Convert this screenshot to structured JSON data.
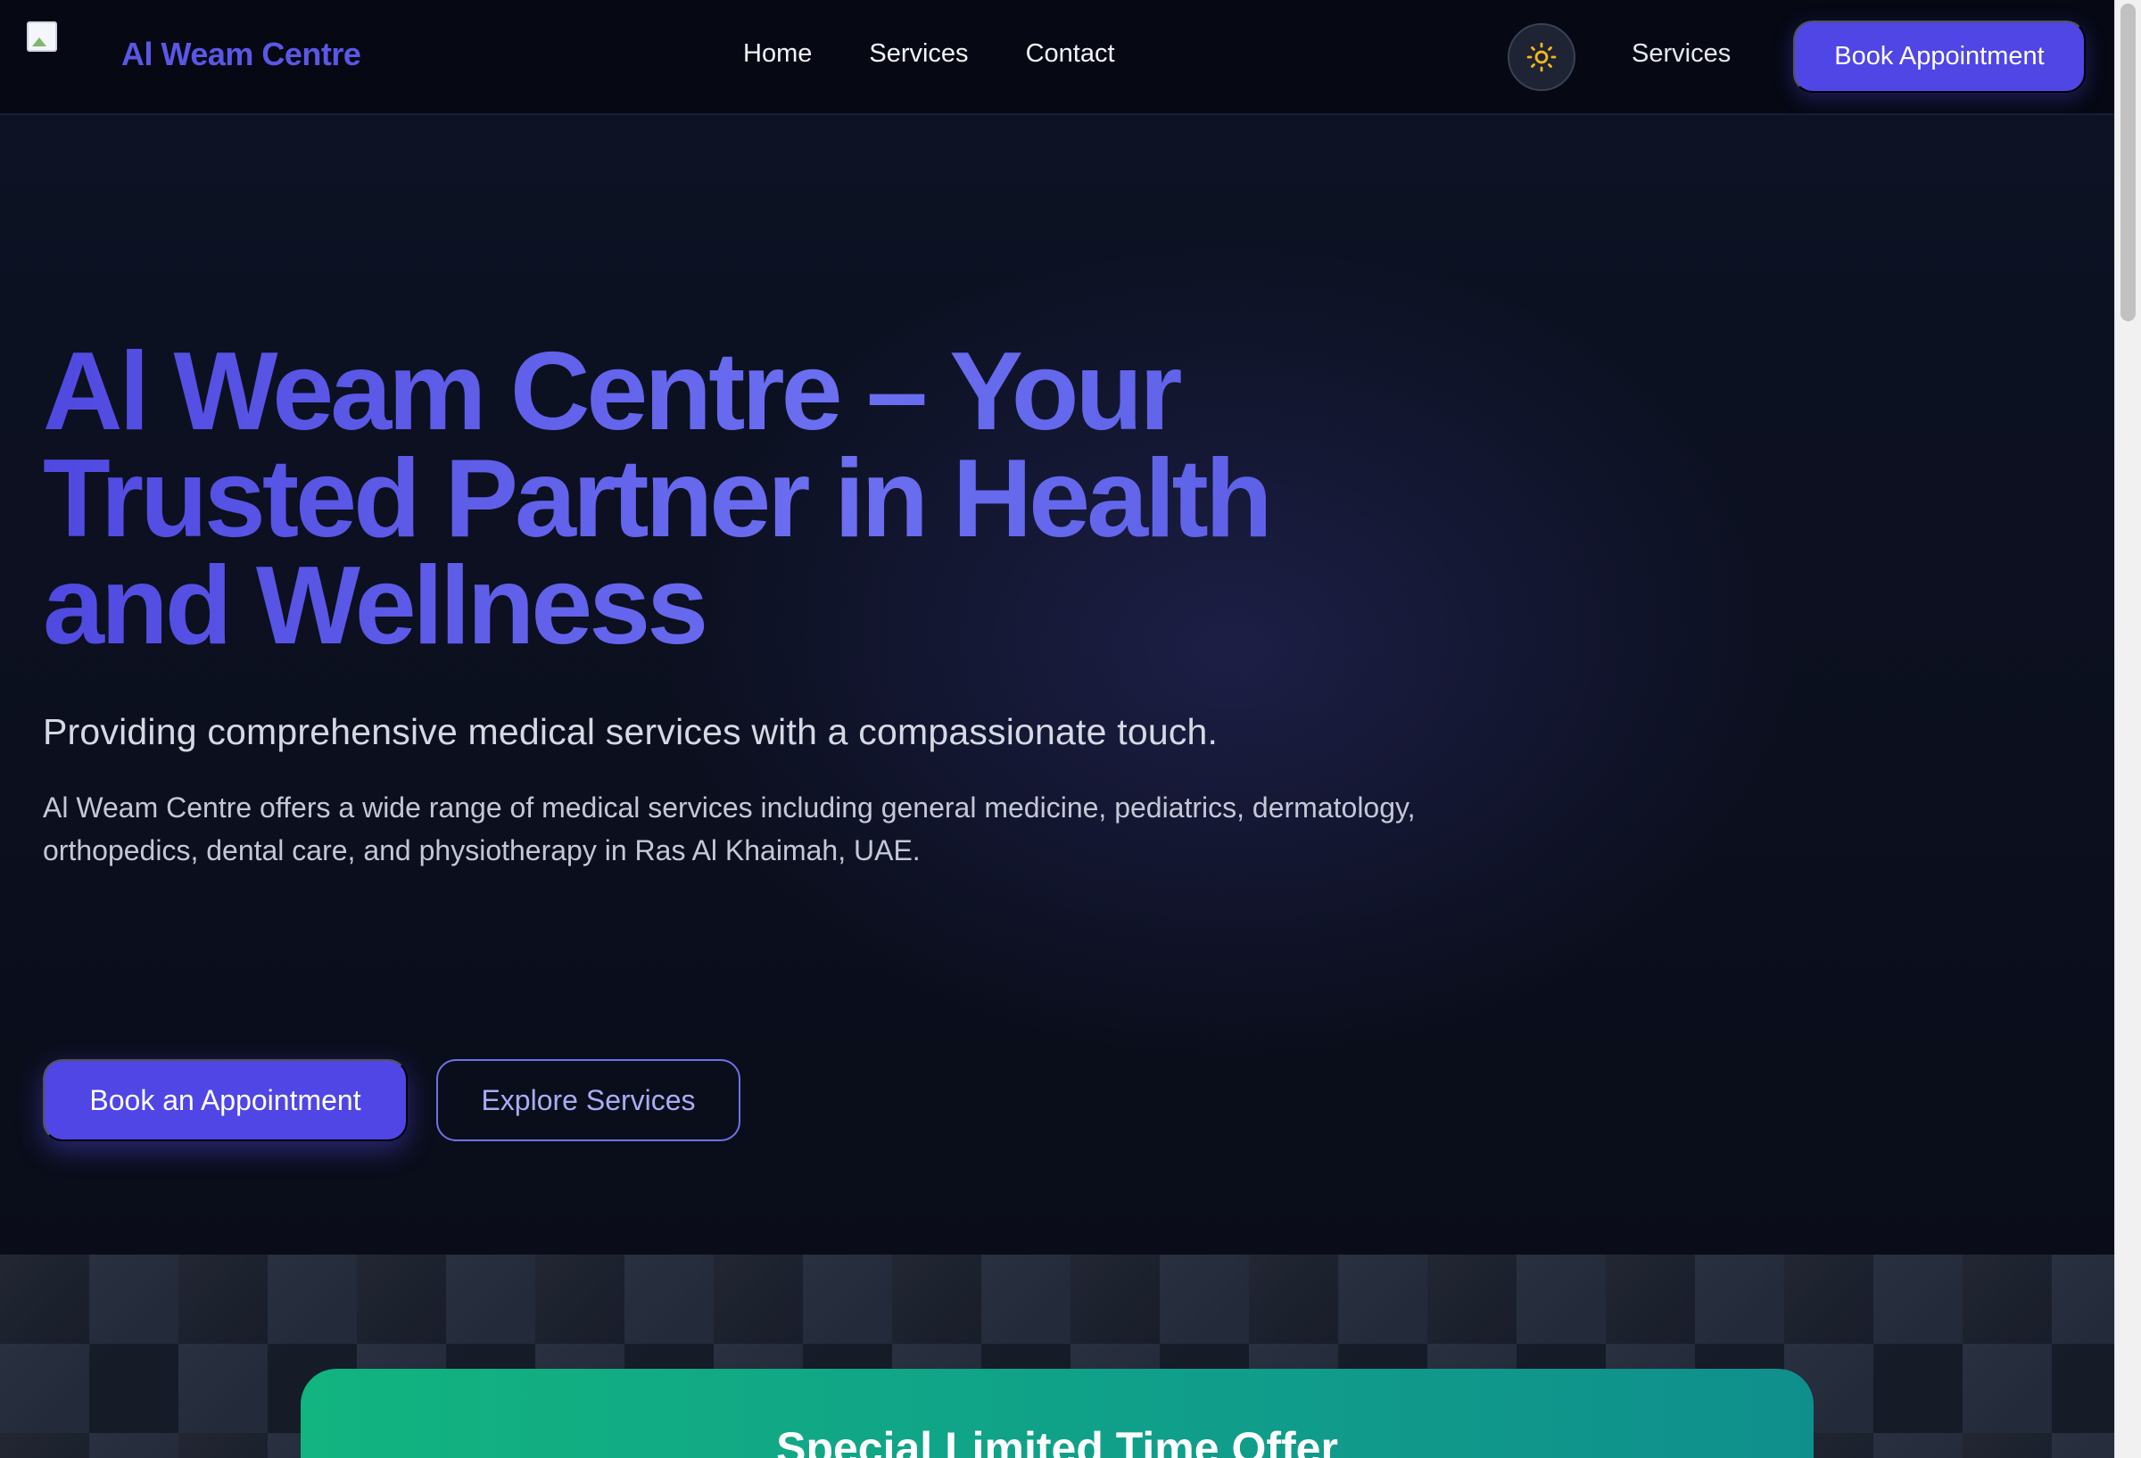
{
  "header": {
    "brand": "Al Weam Centre",
    "nav": [
      "Home",
      "Services",
      "Contact"
    ],
    "secondary_link": "Services",
    "cta": "Book Appointment",
    "theme_icon": "sun-icon"
  },
  "hero": {
    "title": "Al Weam Centre – Your Trusted Partner in Health and Wellness",
    "subtitle": "Providing comprehensive medical services with a compassionate touch.",
    "description": "Al Weam Centre offers a wide range of medical services including general medicine, pediatrics, dermatology, orthopedics, dental care, and physiotherapy in Ras Al Khaimah, UAE.",
    "primary_button": "Book an Appointment",
    "secondary_button": "Explore Services"
  },
  "offer": {
    "title": "Special Limited Time Offer"
  },
  "colors": {
    "accent": "#4f46e5",
    "brand_text": "#5b57e6",
    "offer_green": "#12b47f",
    "sun_icon": "#f5b81c"
  }
}
